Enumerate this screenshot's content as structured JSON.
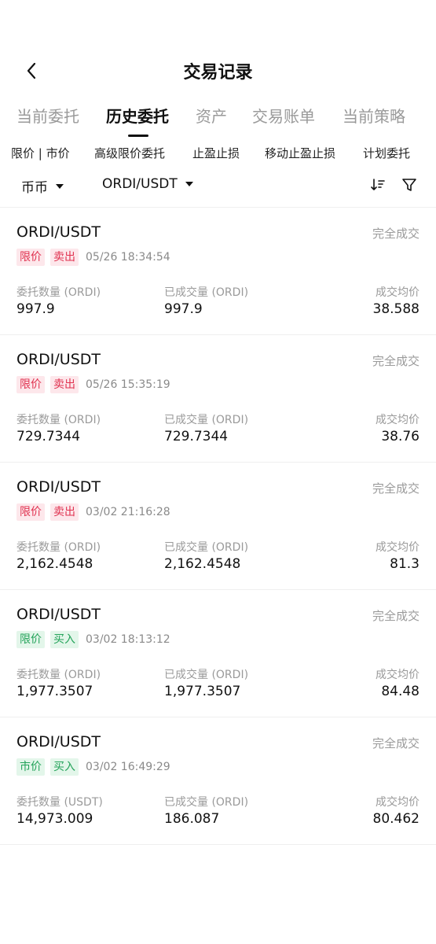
{
  "header": {
    "title": "交易记录",
    "back_icon": "chevron-left-icon"
  },
  "tabs": [
    "当前委托",
    "历史委托",
    "资产",
    "交易账单",
    "当前策略"
  ],
  "active_tab": "历史委托",
  "subtabs": [
    "限价 | 市价",
    "高级限价委托",
    "止盈止损",
    "移动止盈止损",
    "计划委托"
  ],
  "filters": {
    "market": "币币",
    "pair": "ORDI/USDT",
    "sort_icon": "sort-icon",
    "filter_icon": "funnel-icon"
  },
  "labels": {
    "filled_label": "已成交量 (ORDI)",
    "avg_label": "成交均价"
  },
  "colors": {
    "sell": "#e0314f",
    "sell_bg": "#fde7eb",
    "buy": "#24a35a",
    "buy_bg": "#e3f6ea"
  },
  "orders": [
    {
      "pair": "ORDI/USDT",
      "status": "完全成交",
      "type": "限价",
      "side": "卖出",
      "side_kind": "sell",
      "time": "05/26 18:34:54",
      "qty_label": "委托数量 (ORDI)",
      "qty": "997.9",
      "filled": "997.9",
      "avg": "38.588"
    },
    {
      "pair": "ORDI/USDT",
      "status": "完全成交",
      "type": "限价",
      "side": "卖出",
      "side_kind": "sell",
      "time": "05/26 15:35:19",
      "qty_label": "委托数量 (ORDI)",
      "qty": "729.7344",
      "filled": "729.7344",
      "avg": "38.76"
    },
    {
      "pair": "ORDI/USDT",
      "status": "完全成交",
      "type": "限价",
      "side": "卖出",
      "side_kind": "sell",
      "time": "03/02 21:16:28",
      "qty_label": "委托数量 (ORDI)",
      "qty": "2,162.4548",
      "filled": "2,162.4548",
      "avg": "81.3"
    },
    {
      "pair": "ORDI/USDT",
      "status": "完全成交",
      "type": "限价",
      "side": "买入",
      "side_kind": "buy",
      "time": "03/02 18:13:12",
      "qty_label": "委托数量 (ORDI)",
      "qty": "1,977.3507",
      "filled": "1,977.3507",
      "avg": "84.48"
    },
    {
      "pair": "ORDI/USDT",
      "status": "完全成交",
      "type": "市价",
      "side": "买入",
      "side_kind": "buy",
      "time": "03/02 16:49:29",
      "qty_label": "委托数量 (USDT)",
      "qty": "14,973.009",
      "filled": "186.087",
      "avg": "80.462"
    }
  ]
}
